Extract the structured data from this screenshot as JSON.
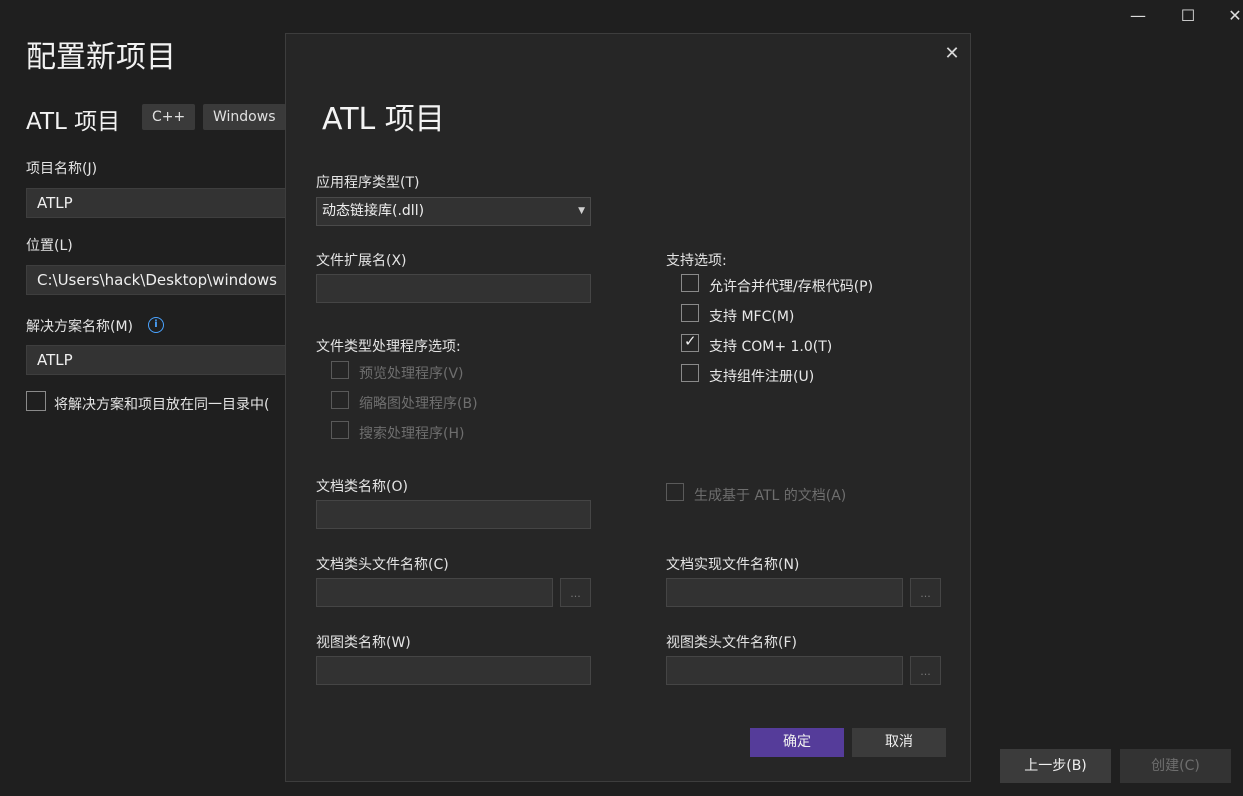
{
  "window": {
    "minimize_glyph": "—",
    "maximize_glyph": "☐",
    "close_glyph": "✕"
  },
  "page": {
    "title": "配置新项目",
    "project_type": "ATL 项目",
    "tags": [
      "C++",
      "Windows"
    ],
    "project_name_label": "项目名称(J)",
    "project_name_value": "ATLP",
    "location_label": "位置(L)",
    "location_value": "C:\\Users\\hack\\Desktop\\windows",
    "solution_name_label": "解决方案名称(M)",
    "solution_name_value": "ATLP",
    "same_dir_label": "将解决方案和项目放在同一目录中(",
    "back_button": "上一步(B)",
    "create_button": "创建(C)"
  },
  "dialog": {
    "title": "ATL 项目",
    "app_type_label": "应用程序类型(T)",
    "app_type_value": "动态链接库(.dll)",
    "file_ext_label": "文件扩展名(X)",
    "support_options_label": "支持选项:",
    "support_options": [
      {
        "label": "允许合并代理/存根代码(P)",
        "checked": false
      },
      {
        "label": "支持 MFC(M)",
        "checked": false
      },
      {
        "label": "支持 COM+ 1.0(T)",
        "checked": true
      },
      {
        "label": "支持组件注册(U)",
        "checked": false
      }
    ],
    "handler_options_label": "文件类型处理程序选项:",
    "handler_options": [
      {
        "label": "预览处理程序(V)"
      },
      {
        "label": "缩略图处理程序(B)"
      },
      {
        "label": "搜索处理程序(H)"
      }
    ],
    "doc_class_label": "文档类名称(O)",
    "gen_atl_doc_label": "生成基于 ATL 的文档(A)",
    "doc_header_label": "文档类头文件名称(C)",
    "doc_impl_label": "文档实现文件名称(N)",
    "view_class_label": "视图类名称(W)",
    "view_header_label": "视图类头文件名称(F)",
    "browse_glyph": "...",
    "ok_button": "确定",
    "cancel_button": "取消",
    "colors": {
      "primary_button": "#553c9a",
      "background": "#262626"
    }
  }
}
